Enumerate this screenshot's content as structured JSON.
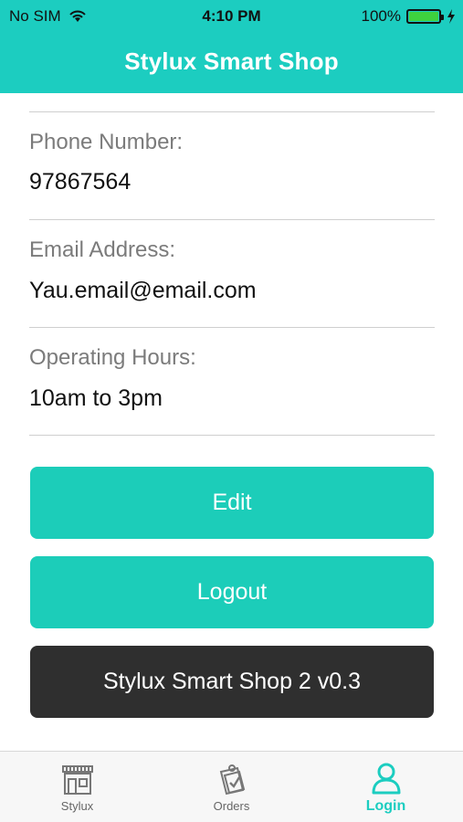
{
  "status_bar": {
    "carrier": "No SIM",
    "time": "4:10 PM",
    "battery": "100%"
  },
  "header": {
    "title": "Stylux Smart Shop"
  },
  "fields": [
    {
      "label": "Phone Number:",
      "value": "97867564"
    },
    {
      "label": "Email Address:",
      "value": "Yau.email@email.com"
    },
    {
      "label": "Operating Hours:",
      "value": "10am to 3pm"
    }
  ],
  "buttons": {
    "edit": "Edit",
    "logout": "Logout",
    "version": "Stylux Smart Shop 2 v0.3"
  },
  "tabs": [
    {
      "label": "Stylux",
      "icon": "shop-icon"
    },
    {
      "label": "Orders",
      "icon": "clipboard-check-icon"
    },
    {
      "label": "Login",
      "icon": "user-icon"
    }
  ],
  "colors": {
    "accent": "#1ccdc0",
    "button": "#1ccdb9",
    "dark": "#2f2f2f"
  }
}
